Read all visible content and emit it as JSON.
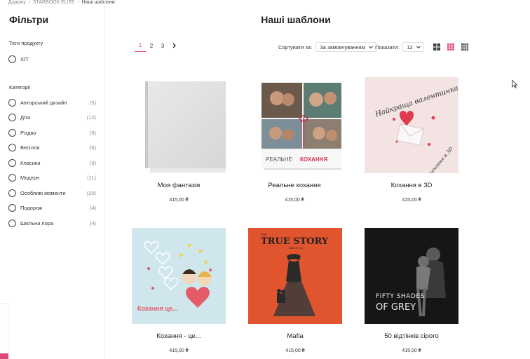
{
  "breadcrumb": {
    "home": "Додому",
    "catalog": "STARBOOK.ELITE",
    "current": "Наші шаблони"
  },
  "sidebar": {
    "title": "Фільтри",
    "tags_label": "Теги продукту",
    "tags": [
      {
        "label": "ХІТ"
      }
    ],
    "categories_label": "Категорії",
    "categories": [
      {
        "label": "Авторський дизайн",
        "count": "(5)"
      },
      {
        "label": "Діти",
        "count": "(12)"
      },
      {
        "label": "Різдво",
        "count": "(5)"
      },
      {
        "label": "Весілля",
        "count": "(6)"
      },
      {
        "label": "Класика",
        "count": "(9)"
      },
      {
        "label": "Модерн",
        "count": "(11)"
      },
      {
        "label": "Особливі моменти",
        "count": "(20)"
      },
      {
        "label": "Подорож",
        "count": "(4)"
      },
      {
        "label": "Шкільна пора",
        "count": "(4)"
      }
    ]
  },
  "main": {
    "title": "Наші шаблони",
    "pagination": {
      "pages": [
        "1",
        "2",
        "3"
      ],
      "active": "1"
    },
    "sort": {
      "label": "Сортувати за:",
      "value": "За замовчуванням"
    },
    "show": {
      "label": "Показати:",
      "value": "12"
    },
    "colors": {
      "accent": "#e2457e"
    }
  },
  "products": [
    {
      "name": "Моя фантазія",
      "price": "415,00 ₴",
      "cover": "blank-grey-album"
    },
    {
      "name": "Реальне кохання",
      "price": "415,00 ₴",
      "cover": "photo-collage-album",
      "cover_text": {
        "word1": "РЕАЛЬНЕ",
        "word2": "КОХАННЯ"
      }
    },
    {
      "name": "Кохання в 3D",
      "price": "415,00 ₴",
      "cover": "heart-envelope",
      "cover_text": {
        "arc": "Найкраща валентинка",
        "corner": "кохання в 3D"
      }
    },
    {
      "name": "Кохання - це...",
      "price": "415,00 ₴",
      "cover": "cartoon-couple",
      "cover_text": {
        "caption": "Кохання це..."
      }
    },
    {
      "name": "Mafia",
      "price": "415,00 ₴",
      "cover": "true-story-silhouette",
      "cover_text": {
        "the": "THE",
        "main": "TRUE STORY",
        "sub": "ABOUT US"
      }
    },
    {
      "name": "50 відтінків сірого",
      "price": "415,00 ₴",
      "cover": "fifty-shades",
      "cover_text": {
        "line1": "FIFTY SHADES",
        "line2": "OF GREY"
      }
    }
  ]
}
